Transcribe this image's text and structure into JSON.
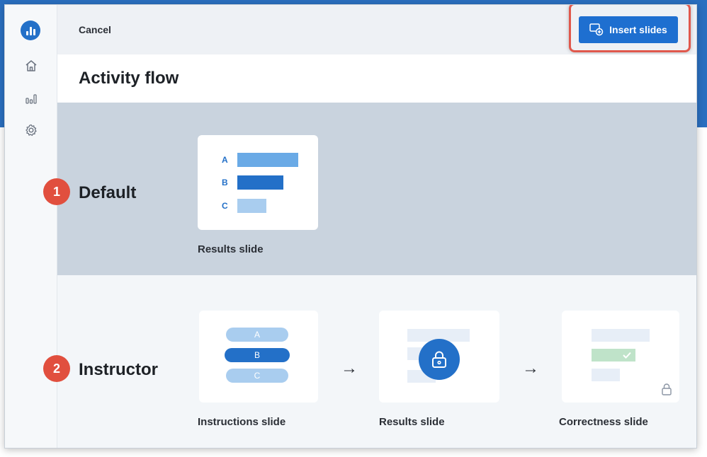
{
  "header": {
    "cancel_label": "Cancel",
    "insert_label": "Insert slides"
  },
  "page_title": "Activity flow",
  "sidebar": {
    "items": [
      {
        "icon": "logo-icon"
      },
      {
        "icon": "home-icon"
      },
      {
        "icon": "bar-chart-icon"
      },
      {
        "icon": "gear-icon"
      }
    ]
  },
  "sections": [
    {
      "number": "1",
      "label": "Default",
      "slides": [
        {
          "caption": "Results slide",
          "bars": [
            {
              "letter": "A"
            },
            {
              "letter": "B"
            },
            {
              "letter": "C"
            }
          ]
        }
      ]
    },
    {
      "number": "2",
      "label": "Instructor",
      "slides": [
        {
          "caption": "Instructions slide",
          "options": [
            "A",
            "B",
            "C"
          ]
        },
        {
          "caption": "Results slide"
        },
        {
          "caption": "Correctness slide"
        }
      ],
      "arrow_glyph": "→"
    }
  ],
  "colors": {
    "accent": "#1e6fd0",
    "badge": "#e14f3e",
    "default_bg": "#c9d3de",
    "correct": "#bfe3c9"
  }
}
